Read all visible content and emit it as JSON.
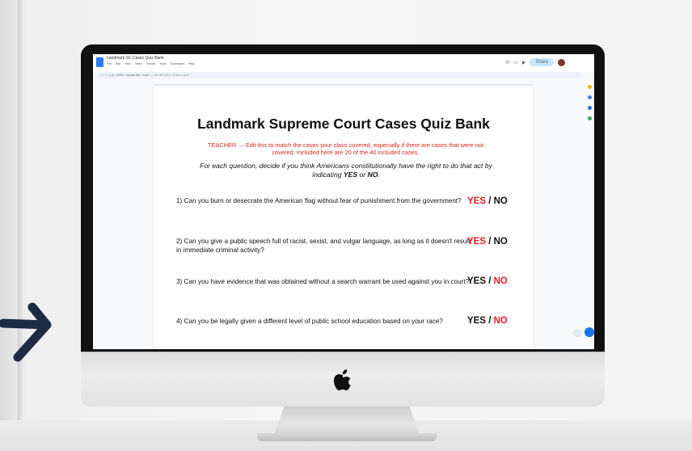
{
  "doc": {
    "tab_title": "Landmark SC Cases Quiz Bank",
    "menu": [
      "File",
      "Edit",
      "View",
      "Insert",
      "Format",
      "Tools",
      "Extensions",
      "Help"
    ],
    "share_label": "Share",
    "heading": "Landmark Supreme Court Cases Quiz Bank",
    "teacher_note": "TEACHER → Edit this to match the cases your class covered, especially if there are cases that were not covered. Included here are 20 of the 40 included cases.",
    "instructions_pre": "For each question, decide if you think Americans constitutionally have the right to do that act by indicating ",
    "yes_word": "YES",
    "or_word": " or ",
    "no_word": "NO",
    "period": ".",
    "questions": [
      {
        "text": "1) Can you burn or desecrate the American flag without fear of punishment from the government?",
        "highlight": "yes"
      },
      {
        "text": "2) Can you give a public speech full of racist, sexist, and vulgar language, as long as it doesn't result in immediate criminal activity?",
        "highlight": "yes"
      },
      {
        "text": "3) Can you have evidence that was obtained without a search warrant be used against you in court?",
        "highlight": "no"
      },
      {
        "text": "4) Can you be legally given a different level of public school education based on your race?",
        "highlight": "no"
      }
    ],
    "yes_label": "YES",
    "slash": " / ",
    "no_label": "NO"
  },
  "colors": {
    "accent_red": "#ee1c24",
    "docs_blue": "#2a7ef4",
    "arrow": "#1f2a44"
  }
}
